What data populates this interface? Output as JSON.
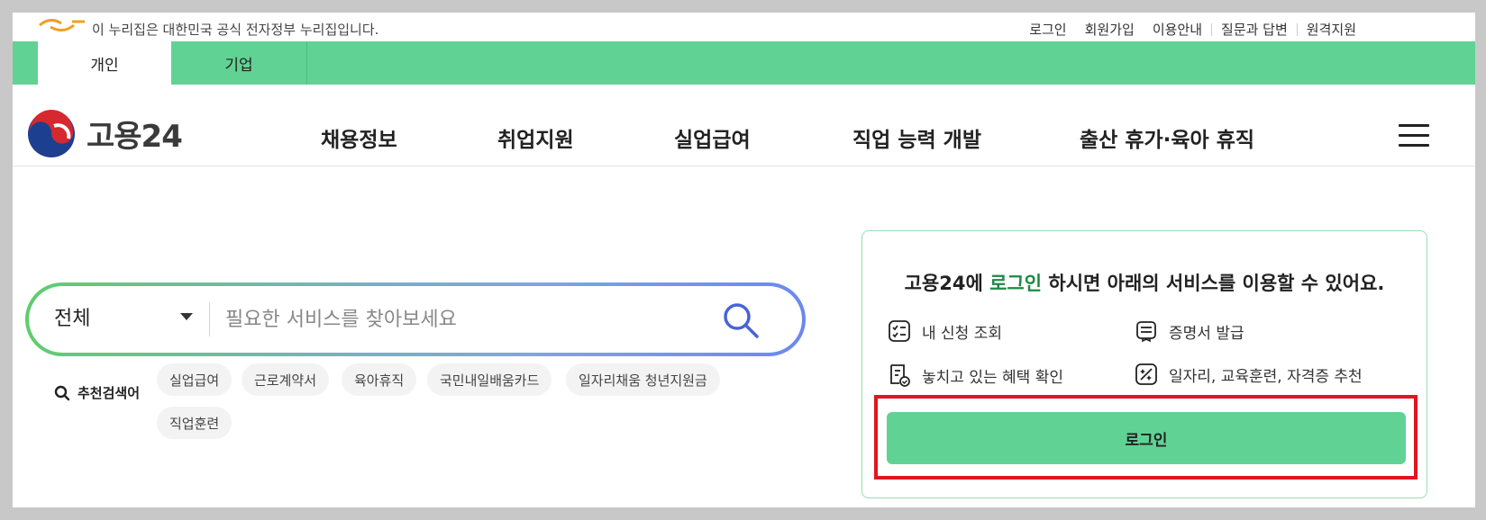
{
  "gov_banner": {
    "text": "이 누리집은 대한민국 공식 전자정부 누리집입니다."
  },
  "utility_links": [
    "로그인",
    "회원가입",
    "이용안내",
    "질문과 답변",
    "원격지원"
  ],
  "audience_tabs": [
    {
      "label": "개인",
      "active": true
    },
    {
      "label": "기업",
      "active": false
    }
  ],
  "site": {
    "logo_text": "고용24"
  },
  "main_menu": [
    "채용정보",
    "취업지원",
    "실업급여",
    "직업 능력 개발",
    "출산 휴가·육아 휴직"
  ],
  "search": {
    "scope": "전체",
    "placeholder": "필요한 서비스를 찾아보세요",
    "value": ""
  },
  "recommended": {
    "label": "추천검색어",
    "keywords": [
      "실업급여",
      "근로계약서",
      "육아휴직",
      "국민내일배움카드",
      "일자리채움 청년지원금",
      "직업훈련"
    ]
  },
  "login_panel": {
    "title_prefix": "고용24에 ",
    "title_highlight": "로그인",
    "title_suffix": " 하시면 아래의 서비스를 이용할 수 있어요.",
    "services": [
      {
        "label": "내 신청 조회",
        "icon": "checklist-icon"
      },
      {
        "label": "증명서 발급",
        "icon": "certificate-icon"
      },
      {
        "label": "놓치고 있는 혜택 확인",
        "icon": "benefit-check-icon"
      },
      {
        "label": "일자리, 교육훈련, 자격증 추천",
        "icon": "recommend-icon"
      }
    ],
    "button_label": "로그인"
  },
  "colors": {
    "brand_green": "#60d394",
    "highlight_text": "#1c8a45",
    "annotation_red": "#e0161e"
  }
}
